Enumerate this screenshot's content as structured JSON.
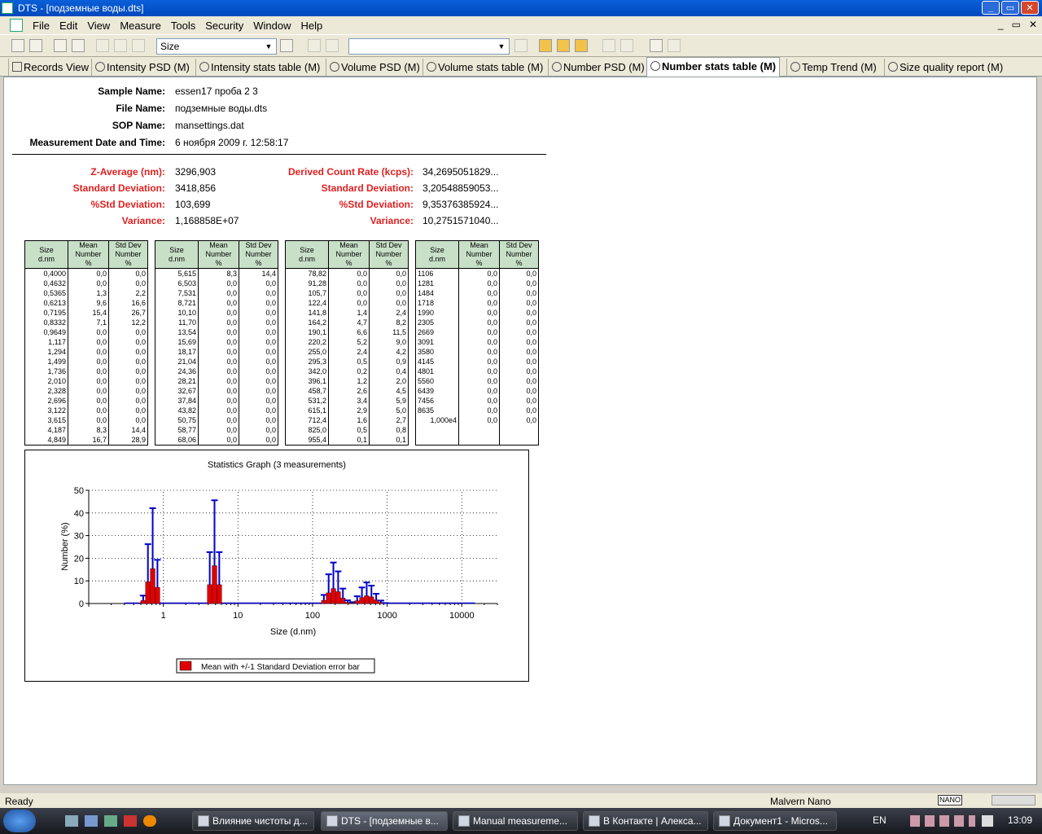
{
  "window": {
    "title": "DTS - [подземные воды.dts]"
  },
  "menu": [
    "File",
    "Edit",
    "View",
    "Measure",
    "Tools",
    "Security",
    "Window",
    "Help"
  ],
  "toolbar": {
    "size_select": "Size",
    "second_select": ""
  },
  "tabs": [
    "Records View",
    "Intensity PSD (M)",
    "Intensity stats table (M)",
    "Volume PSD (M)",
    "Volume stats table (M)",
    "Number PSD (M)",
    "Number stats table (M)",
    "Temp Trend (M)",
    "Size quality report (M)"
  ],
  "active_tab": "Number stats table (M)",
  "sample": {
    "sample_name_label": "Sample Name:",
    "sample_name": "essen17 проба 2 3",
    "file_name_label": "File Name:",
    "file_name": "подземные воды.dts",
    "sop_label": "SOP Name:",
    "sop": "mansettings.dat",
    "date_label": "Measurement Date and Time:",
    "date": "6 ноября 2009 г. 12:58:17"
  },
  "stats_left": [
    {
      "label": "Z-Average (nm):",
      "value": "3296,903"
    },
    {
      "label": "Standard Deviation:",
      "value": "3418,856"
    },
    {
      "label": "%Std Deviation:",
      "value": "103,699"
    },
    {
      "label": "Variance:",
      "value": "1,168858E+07"
    }
  ],
  "stats_right": [
    {
      "label": "Derived Count Rate (kcps):",
      "value": "34,2695051829..."
    },
    {
      "label": "Standard Deviation:",
      "value": "3,20548859053..."
    },
    {
      "label": "%Std Deviation:",
      "value": "9,35376385924..."
    },
    {
      "label": "Variance:",
      "value": "10,2751571040..."
    }
  ],
  "table_headers": [
    "Size d.nm",
    "Mean Number %",
    "Std Dev Number %"
  ],
  "tables": [
    [
      [
        "0,4000",
        "0,0",
        "0,0"
      ],
      [
        "0,4632",
        "0,0",
        "0,0"
      ],
      [
        "0,5365",
        "1,3",
        "2,2"
      ],
      [
        "0,6213",
        "9,6",
        "16,6"
      ],
      [
        "0,7195",
        "15,4",
        "26,7"
      ],
      [
        "0,8332",
        "7,1",
        "12,2"
      ],
      [
        "0,9649",
        "0,0",
        "0,0"
      ],
      [
        "1,117",
        "0,0",
        "0,0"
      ],
      [
        "1,294",
        "0,0",
        "0,0"
      ],
      [
        "1,499",
        "0,0",
        "0,0"
      ],
      [
        "1,736",
        "0,0",
        "0,0"
      ],
      [
        "2,010",
        "0,0",
        "0,0"
      ],
      [
        "2,328",
        "0,0",
        "0,0"
      ],
      [
        "2,696",
        "0,0",
        "0,0"
      ],
      [
        "3,122",
        "0,0",
        "0,0"
      ],
      [
        "3,615",
        "0,0",
        "0,0"
      ],
      [
        "4,187",
        "8,3",
        "14,4"
      ],
      [
        "4,849",
        "16,7",
        "28,9"
      ]
    ],
    [
      [
        "5,615",
        "8,3",
        "14,4"
      ],
      [
        "6,503",
        "0,0",
        "0,0"
      ],
      [
        "7,531",
        "0,0",
        "0,0"
      ],
      [
        "8,721",
        "0,0",
        "0,0"
      ],
      [
        "10,10",
        "0,0",
        "0,0"
      ],
      [
        "11,70",
        "0,0",
        "0,0"
      ],
      [
        "13,54",
        "0,0",
        "0,0"
      ],
      [
        "15,69",
        "0,0",
        "0,0"
      ],
      [
        "18,17",
        "0,0",
        "0,0"
      ],
      [
        "21,04",
        "0,0",
        "0,0"
      ],
      [
        "24,36",
        "0,0",
        "0,0"
      ],
      [
        "28,21",
        "0,0",
        "0,0"
      ],
      [
        "32,67",
        "0,0",
        "0,0"
      ],
      [
        "37,84",
        "0,0",
        "0,0"
      ],
      [
        "43,82",
        "0,0",
        "0,0"
      ],
      [
        "50,75",
        "0,0",
        "0,0"
      ],
      [
        "58,77",
        "0,0",
        "0,0"
      ],
      [
        "68,06",
        "0,0",
        "0,0"
      ]
    ],
    [
      [
        "78,82",
        "0,0",
        "0,0"
      ],
      [
        "91,28",
        "0,0",
        "0,0"
      ],
      [
        "105,7",
        "0,0",
        "0,0"
      ],
      [
        "122,4",
        "0,0",
        "0,0"
      ],
      [
        "141,8",
        "1,4",
        "2,4"
      ],
      [
        "164,2",
        "4,7",
        "8,2"
      ],
      [
        "190,1",
        "6,6",
        "11,5"
      ],
      [
        "220,2",
        "5,2",
        "9,0"
      ],
      [
        "255,0",
        "2,4",
        "4,2"
      ],
      [
        "295,3",
        "0,5",
        "0,9"
      ],
      [
        "342,0",
        "0,2",
        "0,4"
      ],
      [
        "396,1",
        "1,2",
        "2,0"
      ],
      [
        "458,7",
        "2,6",
        "4,5"
      ],
      [
        "531,2",
        "3,4",
        "5,9"
      ],
      [
        "615,1",
        "2,9",
        "5,0"
      ],
      [
        "712,4",
        "1,6",
        "2,7"
      ],
      [
        "825,0",
        "0,5",
        "0,8"
      ],
      [
        "955,4",
        "0,1",
        "0,1"
      ]
    ],
    [
      [
        "1106",
        "0,0",
        "0,0"
      ],
      [
        "1281",
        "0,0",
        "0,0"
      ],
      [
        "1484",
        "0,0",
        "0,0"
      ],
      [
        "1718",
        "0,0",
        "0,0"
      ],
      [
        "1990",
        "0,0",
        "0,0"
      ],
      [
        "2305",
        "0,0",
        "0,0"
      ],
      [
        "2669",
        "0,0",
        "0,0"
      ],
      [
        "3091",
        "0,0",
        "0,0"
      ],
      [
        "3580",
        "0,0",
        "0,0"
      ],
      [
        "4145",
        "0,0",
        "0,0"
      ],
      [
        "4801",
        "0,0",
        "0,0"
      ],
      [
        "5560",
        "0,0",
        "0,0"
      ],
      [
        "6439",
        "0,0",
        "0,0"
      ],
      [
        "7456",
        "0,0",
        "0,0"
      ],
      [
        "8635",
        "0,0",
        "0,0"
      ],
      [
        "1,000e4",
        "0,0",
        "0,0"
      ],
      [
        "",
        "",
        ""
      ],
      [
        "",
        "",
        ""
      ]
    ]
  ],
  "chart_data": {
    "type": "bar",
    "title": "Statistics Graph (3 measurements)",
    "xlabel": "Size (d.nm)",
    "ylabel": "Number (%)",
    "xscale": "log",
    "xlim": [
      0.1,
      30000
    ],
    "ylim": [
      0,
      50
    ],
    "xticks": [
      "1",
      "10",
      "100",
      "1000",
      "10000"
    ],
    "yticks": [
      0,
      10,
      20,
      30,
      40,
      50
    ],
    "grid": "dotted",
    "legend": "bottom-center",
    "series": [
      {
        "name": "Mean with +/-1 Standard Deviation error bar",
        "color": "#e00000",
        "errorbar_color": "#0000c8"
      }
    ],
    "x": [
      0.5365,
      0.6213,
      0.7195,
      0.8332,
      4.187,
      4.849,
      5.615,
      141.8,
      164.2,
      190.1,
      220.2,
      255.0,
      295.3,
      342.0,
      396.1,
      458.7,
      531.2,
      615.1,
      712.4,
      825.0,
      955.4
    ],
    "values": [
      1.3,
      9.6,
      15.4,
      7.1,
      8.3,
      16.7,
      8.3,
      1.4,
      4.7,
      6.6,
      5.2,
      2.4,
      0.5,
      0.2,
      1.2,
      2.6,
      3.4,
      2.9,
      1.6,
      0.5,
      0.1
    ],
    "errors": [
      2.2,
      16.6,
      26.7,
      12.2,
      14.4,
      28.9,
      14.4,
      2.4,
      8.2,
      11.5,
      9.0,
      4.2,
      0.9,
      0.4,
      2.0,
      4.5,
      5.9,
      5.0,
      2.7,
      0.8,
      0.1
    ]
  },
  "status": {
    "left": "Ready",
    "right": "Malvern Nano"
  },
  "taskbar": {
    "items": [
      "Влияние чистоты д...",
      "DTS - [подземные в...",
      "Manual measureme...",
      "В Контакте | Алекса...",
      "Документ1 - Micros..."
    ],
    "lang": "EN",
    "clock": "13:09"
  }
}
